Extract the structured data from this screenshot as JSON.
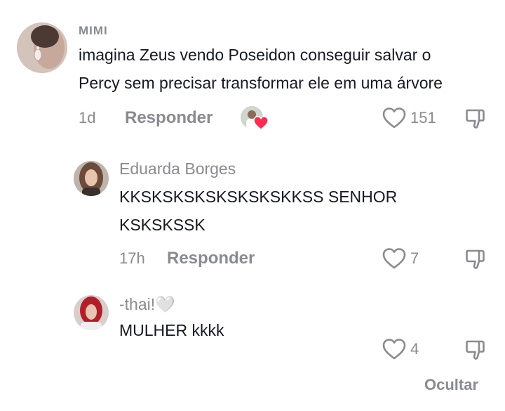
{
  "comments": [
    {
      "username": "MIMI",
      "text_lines": [
        "imagina Zeus vendo Poseidon conseguir salvar o",
        "Percy sem precisar transformar ele em uma árvore"
      ],
      "time": "1d",
      "reply_label": "Responder",
      "likes": "151"
    },
    {
      "username": "Eduarda Borges",
      "text_lines": [
        "KKSKSKSKSKSKSKSKKSS SENHOR",
        "KSKSKSSK"
      ],
      "time": "17h",
      "reply_label": "Responder",
      "likes": "7"
    },
    {
      "username": "-thai!",
      "username_emoji": "🤍",
      "text_lines": [
        "MULHER kkkk"
      ],
      "likes": "4"
    }
  ],
  "hide_label": "Ocultar",
  "colors": {
    "heart_badge": "#fe2c55",
    "muted": "#8a8b91"
  }
}
